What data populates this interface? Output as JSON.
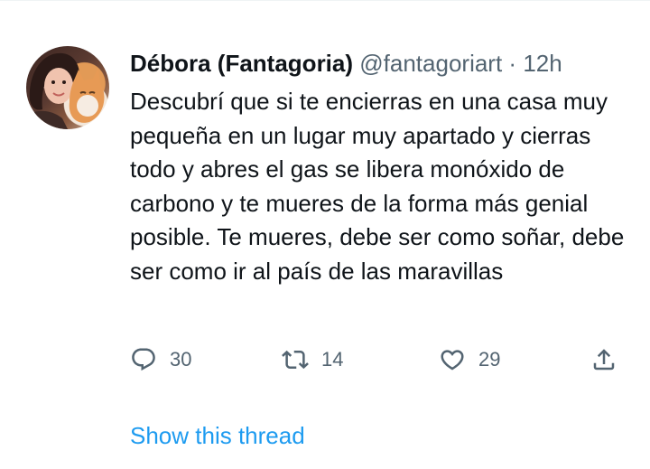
{
  "tweet": {
    "display_name": "Débora (Fantagoria)",
    "handle": "@fantagoriart",
    "separator": "·",
    "time": "12h",
    "text": "Descubrí que si te encierras en una casa muy pequeña en un lugar muy apartado y cierras todo y abres el gas se libera monóxido de carbono y te mueres de la forma más genial posible. Te mueres, debe ser como soñar, debe ser como ir al país de las maravillas"
  },
  "actions": {
    "reply_count": "30",
    "retweet_count": "14",
    "like_count": "29"
  },
  "thread": {
    "link_label": "Show this thread"
  },
  "icons": {
    "reply": "reply-icon",
    "retweet": "retweet-icon",
    "like": "heart-icon",
    "share": "share-icon"
  },
  "colors": {
    "text": "#0f1419",
    "secondary": "#536471",
    "link": "#1d9bf0"
  }
}
